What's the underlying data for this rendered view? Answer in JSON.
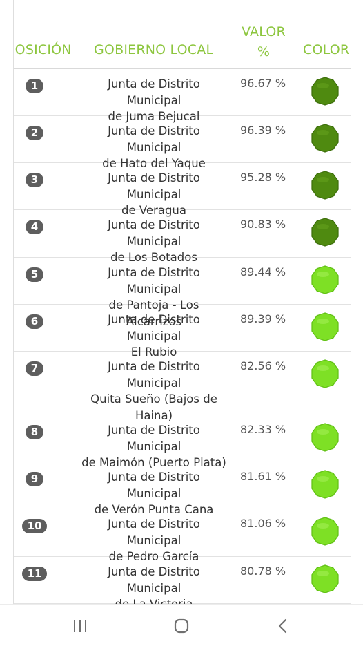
{
  "header": {
    "position": "POSICIÓN",
    "gobierno": "GOBIERNO LOCAL",
    "valor_line1": "VALOR",
    "valor_line2": "%",
    "color": "COLOR"
  },
  "colors": {
    "header_text": "#8dc63f",
    "dark_green": "#4f8a10",
    "light_green": "#7ee025",
    "badge": "#5e5e5e"
  },
  "rows": [
    {
      "rank": "1",
      "line1": "Junta de Distrito Municipal",
      "line2": "de Juma Bejucal",
      "line3": "",
      "value": "96.67  %",
      "color": "dark"
    },
    {
      "rank": "2",
      "line1": "Junta de Distrito Municipal",
      "line2": "de Hato del Yaque",
      "line3": "",
      "value": "96.39  %",
      "color": "dark"
    },
    {
      "rank": "3",
      "line1": "Junta de Distrito Municipal",
      "line2": "de Veragua",
      "line3": "",
      "value": "95.28  %",
      "color": "dark"
    },
    {
      "rank": "4",
      "line1": "Junta de Distrito Municipal",
      "line2": "de Los Botados",
      "line3": "",
      "value": "90.83  %",
      "color": "dark"
    },
    {
      "rank": "5",
      "line1": "Junta de Distrito Municipal",
      "line2": "de Pantoja - Los Alcarrizos",
      "line3": "",
      "value": "89.44  %",
      "color": "light"
    },
    {
      "rank": "6",
      "line1": "Junta de Distrito Municipal",
      "line2": "El Rubio",
      "line3": "",
      "value": "89.39  %",
      "color": "light"
    },
    {
      "rank": "7",
      "line1": "Junta de Distrito Municipal",
      "line2": "Quita Sueño (Bajos de",
      "line3": "Haina)",
      "value": "82.56  %",
      "color": "light"
    },
    {
      "rank": "8",
      "line1": "Junta de Distrito Municipal",
      "line2": "de Maimón (Puerto Plata)",
      "line3": "",
      "value": "82.33  %",
      "color": "light"
    },
    {
      "rank": "9",
      "line1": "Junta de Distrito Municipal",
      "line2": "de Verón Punta Cana",
      "line3": "",
      "value": "81.61  %",
      "color": "light"
    },
    {
      "rank": "10",
      "line1": "Junta de Distrito Municipal",
      "line2": "de Pedro García",
      "line3": "",
      "value": "81.06  %",
      "color": "light"
    },
    {
      "rank": "11",
      "line1": "Junta de Distrito Municipal",
      "line2": "de La Victoria",
      "line3": "",
      "value": "80.78  %",
      "color": "light"
    }
  ],
  "navbar": {
    "recent_icon": "recent-apps-icon",
    "home_icon": "home-icon",
    "back_icon": "back-icon"
  }
}
